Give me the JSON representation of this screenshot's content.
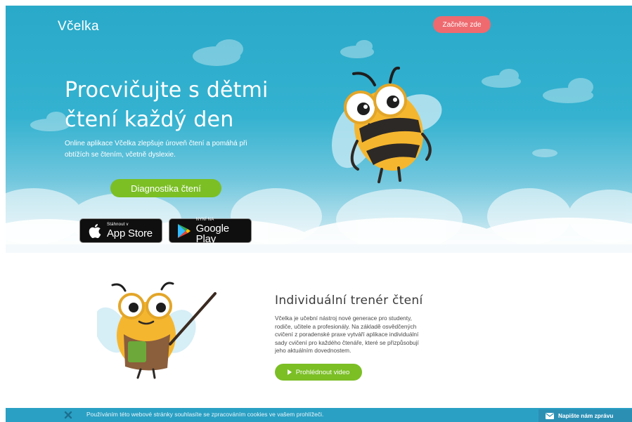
{
  "header": {
    "brand": "Včelka",
    "start_button": "Začněte zde"
  },
  "hero": {
    "title_line1": "Procvičujte s dětmi",
    "title_line2": "čtení každý den",
    "subtitle_line1": "Online aplikace Včelka zlepšuje úroveň čtení a pomáhá při",
    "subtitle_line2": "obtížích se čtením, včetně dyslexie.",
    "diagnostics_button": "Diagnostika čtení",
    "app_store": {
      "small": "Stáhnout v",
      "big": "App Store",
      "icon": "apple-icon"
    },
    "google_play": {
      "small": "NYNÍ NA",
      "big": "Google Play",
      "icon": "google-play-icon"
    }
  },
  "trainer": {
    "title": "Individuální trenér čtení",
    "body_lines": [
      "Včelka je učební nástroj nové generace pro studenty,",
      "rodiče, učitele a profesionály. Na základě osvědčených",
      "cvičení z poradenské praxe vytváří aplikace individuální",
      "sady cvičení pro každého čtenáře, které se přizpůsobují",
      "jeho aktuálním dovednostem."
    ],
    "video_button": "Prohlédnout video"
  },
  "cookie_bar": {
    "text": "Používáním této webové stránky souhlasíte se zpracováním cookies ve vašem prohlížeči.",
    "close_icon": "close-icon"
  },
  "message_button": {
    "label": "Napište nám zprávu",
    "icon": "envelope-icon"
  },
  "colors": {
    "sky": "#2aa9c9",
    "accent_green": "#7bbf25",
    "accent_coral": "#ee6a6f",
    "cookie_bar": "#2aa0c4"
  }
}
